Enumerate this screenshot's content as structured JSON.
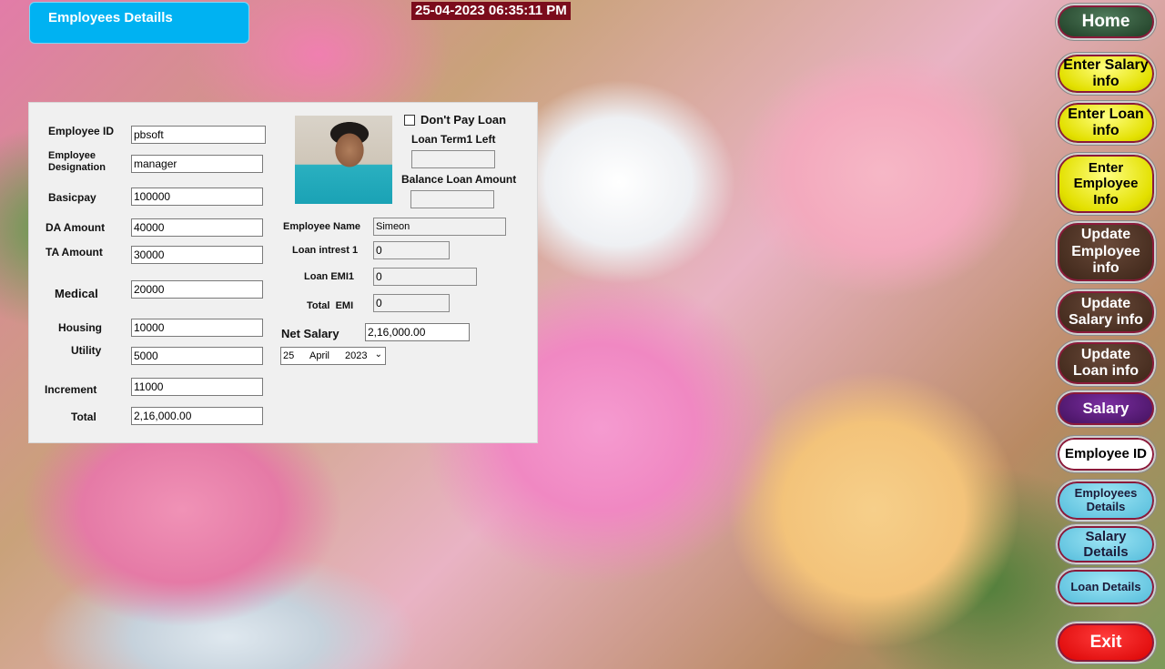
{
  "header": {
    "title": "Employees Detaills",
    "datetime": "25-04-2023 06:35:11 PM"
  },
  "form": {
    "employee_id": {
      "label": "Employee ID",
      "value": "pbsoft"
    },
    "designation": {
      "label_line1": "Employee",
      "label_line2": "Designation",
      "value": "manager"
    },
    "basicpay": {
      "label": "Basicpay",
      "value": "100000"
    },
    "da_amount": {
      "label": "DA Amount",
      "value": "40000"
    },
    "ta_amount": {
      "label": "TA Amount",
      "value": "30000"
    },
    "medical": {
      "label": "Medical",
      "value": "20000"
    },
    "housing": {
      "label": "Housing",
      "value": "10000"
    },
    "utility": {
      "label": "Utility",
      "value": "5000"
    },
    "increment": {
      "label": "Increment",
      "value": "11000"
    },
    "total": {
      "label": "Total",
      "value": "2,16,000.00"
    },
    "dont_pay_loan": {
      "label": "Don't Pay Loan",
      "checked": false
    },
    "loan_term_left": {
      "label": "Loan Term1 Left",
      "value": ""
    },
    "balance_loan_amount": {
      "label": "Balance Loan Amount",
      "value": ""
    },
    "employee_name": {
      "label": "Employee Name",
      "value": "Simeon"
    },
    "loan_interest": {
      "label": "Loan intrest 1",
      "value": "0"
    },
    "loan_emi": {
      "label": "Loan EMI1",
      "value": "0"
    },
    "total_emi": {
      "label": "Total  EMI",
      "value": "0"
    },
    "net_salary": {
      "label": "Net Salary",
      "value": "2,16,000.00"
    },
    "date": {
      "day": "25",
      "month": "April",
      "year": "2023"
    }
  },
  "nav": {
    "home": "Home",
    "enter_salary_info": [
      "Enter Salary",
      "info"
    ],
    "enter_loan_info": [
      "Enter Loan",
      "info"
    ],
    "enter_employee_info": [
      "Enter",
      "Employee",
      "Info"
    ],
    "update_employee_info": [
      "Update",
      "Employee",
      "info"
    ],
    "update_salary_info": [
      "Update",
      "Salary info"
    ],
    "update_loan_info": [
      "Update",
      "Loan info"
    ],
    "salary": "Salary",
    "employee_id": "Employee ID",
    "employees_details": [
      "Employees",
      "Details"
    ],
    "salary_details": [
      "Salary",
      "Details"
    ],
    "loan_details": "Loan Details",
    "exit": "Exit"
  }
}
